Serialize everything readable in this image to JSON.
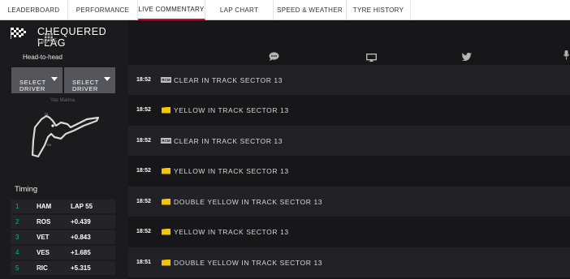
{
  "nav": {
    "tabs": [
      {
        "label": "LEADERBOARD"
      },
      {
        "label": "PERFORMANCE"
      },
      {
        "label": "LIVE COMMENTARY",
        "active": true
      },
      {
        "label": "LAP CHART"
      },
      {
        "label": "SPEED & WEATHER"
      },
      {
        "label": "TYRE HISTORY"
      }
    ]
  },
  "status": {
    "title": "CHEQUERED FLAG",
    "lap": "Lap 55"
  },
  "head_to_head": {
    "heading": "Head-to-head",
    "select1": "SELECT\nDRIVER",
    "select2": "SELECT\nDRIVER"
  },
  "circuit": {
    "name": "Yas Marina",
    "marker1": "S1",
    "marker2": "S3"
  },
  "timing": {
    "heading": "Timing",
    "rows": [
      {
        "pos": "1",
        "driver": "HAM",
        "gap": "LAP 55"
      },
      {
        "pos": "2",
        "driver": "ROS",
        "gap": "+0.439"
      },
      {
        "pos": "3",
        "driver": "VET",
        "gap": "+0.843"
      },
      {
        "pos": "4",
        "driver": "VES",
        "gap": "+1.685"
      },
      {
        "pos": "5",
        "driver": "RIC",
        "gap": "+5.315"
      }
    ]
  },
  "toolbar": {
    "icons": [
      "grid-icon",
      "chat-icon",
      "tv-icon",
      "twitter-icon",
      "microphone-icon"
    ]
  },
  "commentary": [
    {
      "time": "18:52",
      "type": "rcm",
      "badge": "RCM",
      "text": "CLEAR IN TRACK SECTOR 13"
    },
    {
      "time": "18:52",
      "type": "yellow",
      "text": "YELLOW IN TRACK SECTOR 13"
    },
    {
      "time": "18:52",
      "type": "rcm",
      "badge": "RCM",
      "text": "CLEAR IN TRACK SECTOR 13"
    },
    {
      "time": "18:52",
      "type": "yellow",
      "text": "YELLOW IN TRACK SECTOR 13"
    },
    {
      "time": "18:52",
      "type": "yellow",
      "text": "DOUBLE YELLOW IN TRACK SECTOR 13"
    },
    {
      "time": "18:52",
      "type": "yellow",
      "text": "YELLOW IN TRACK SECTOR 13"
    },
    {
      "time": "18:51",
      "type": "yellow",
      "text": "DOUBLE YELLOW IN TRACK SECTOR 13"
    }
  ],
  "colors": {
    "accent": "#c8102e",
    "position": "#00b89c",
    "yellow_flag": "#f6c400"
  }
}
